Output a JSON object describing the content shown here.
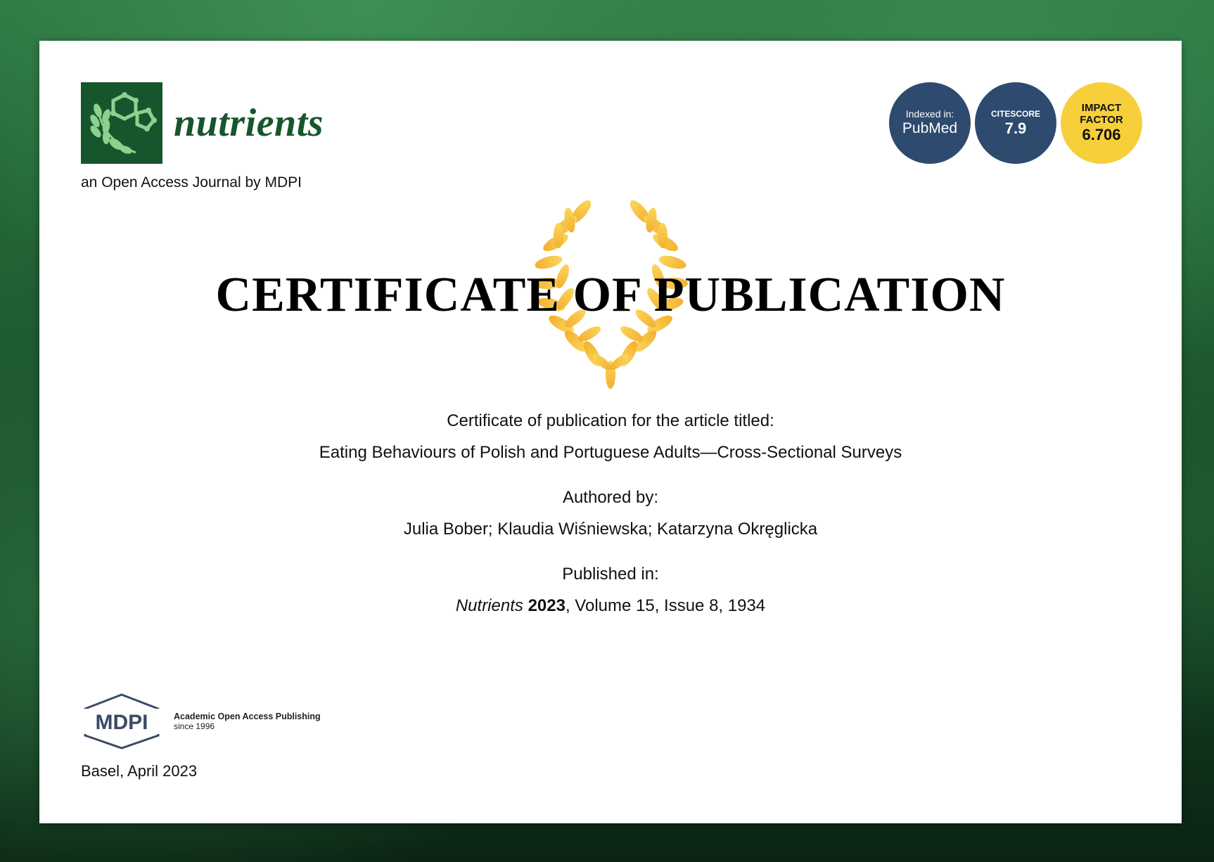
{
  "journal": {
    "name": "nutrients",
    "subtitle": "an Open Access Journal by MDPI",
    "brand_color": "#17562d"
  },
  "badges": {
    "pubmed": {
      "line1": "Indexed in:",
      "line2": "PubMed",
      "color": "#2e4a6f"
    },
    "citescore": {
      "label": "CITESCORE",
      "value": "7.9",
      "color": "#2e4a6f"
    },
    "impact": {
      "line1": "IMPACT",
      "line2": "FACTOR",
      "value": "6.706",
      "color": "#f7cf3a"
    }
  },
  "certificate": {
    "title": "CERTIFICATE OF PUBLICATION",
    "intro": "Certificate of publication for the article titled:",
    "article_title": "Eating Behaviours of Polish and Portuguese Adults—Cross-Sectional Surveys",
    "authored_label": "Authored by:",
    "authors": "Julia Bober; Klaudia Wiśniewska; Katarzyna Okręglicka",
    "published_label": "Published in:",
    "journal_italic": "Nutrients",
    "year": "2023",
    "citation_rest": ", Volume 15, Issue 8, 1934"
  },
  "publisher": {
    "name": "MDPI",
    "tagline": "Academic Open Access Publishing",
    "since": "since 1996"
  },
  "footer": {
    "place_date": "Basel, April 2023"
  },
  "colors": {
    "laurel": "#f5b81c",
    "background": "#2e7a45"
  }
}
